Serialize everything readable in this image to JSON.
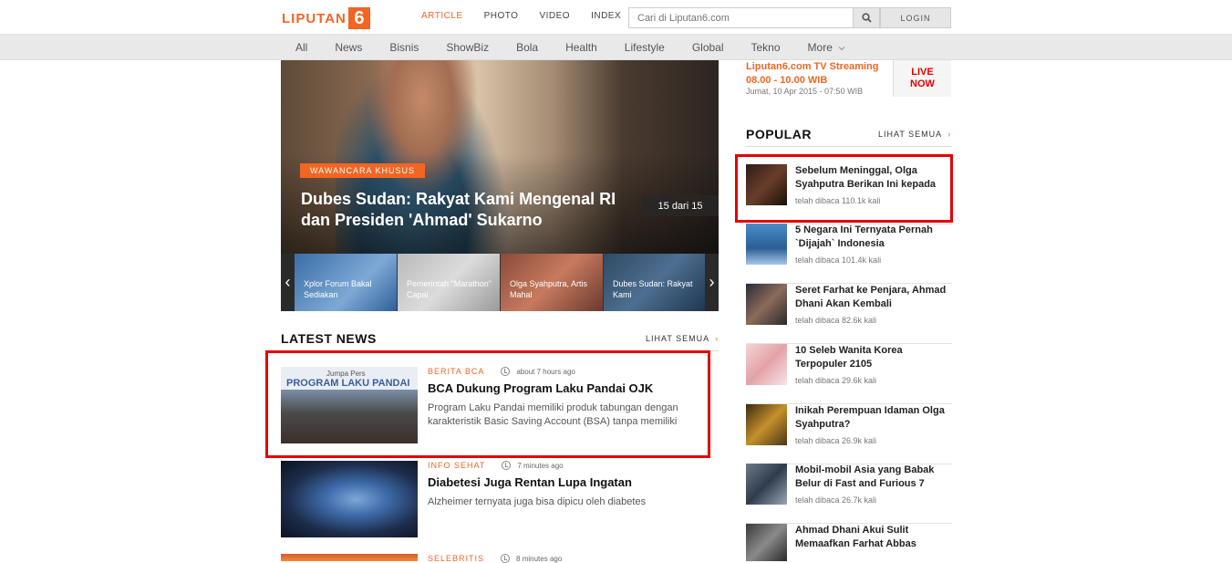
{
  "header": {
    "logo_text": "LIPUTAN",
    "logo_number": "6",
    "nav": [
      "ARTICLE",
      "PHOTO",
      "VIDEO",
      "INDEX"
    ],
    "search_placeholder": "Cari di Liputan6.com",
    "login_label": "LOGIN"
  },
  "categories": [
    "All",
    "News",
    "Bisnis",
    "ShowBiz",
    "Bola",
    "Health",
    "Lifestyle",
    "Global",
    "Tekno",
    "More"
  ],
  "hero": {
    "badge": "WAWANCARA KHUSUS",
    "title": "Dubes Sudan: Rakyat Kami Mengenal RI dan Presiden 'Ahmad' Sukarno",
    "counter": "15 dari 15",
    "thumbs": [
      "Xplor Forum Bakal Sediakan",
      "Pemerintah \"Marathon\" Capai",
      "Olga Syahputra, Artis Mahal",
      "Dubes Sudan: Rakyat Kami"
    ]
  },
  "latest": {
    "title": "LATEST NEWS",
    "link": "LIHAT SEMUA",
    "items": [
      {
        "category": "BERITA BCA",
        "time": "about 7 hours ago",
        "title": "BCA Dukung Program Laku Pandai OJK",
        "excerpt": "Program Laku Pandai memiliki produk tabungan dengan karakteristik Basic Saving Account (BSA) tanpa memiliki",
        "image_caption_1": "Jumpa Pers",
        "image_caption_2": "PROGRAM LAKU PANDAI"
      },
      {
        "category": "INFO SEHAT",
        "time": "7 minutes ago",
        "title": "Diabetesi Juga Rentan Lupa Ingatan",
        "excerpt": "Alzheimer ternyata juga bisa dipicu oleh diabetes"
      },
      {
        "category": "SELEBRITIS",
        "time": "8 minutes ago"
      }
    ]
  },
  "tv": {
    "title": "Liputan6.com TV Streaming",
    "time": "08.00 - 10.00 WIB",
    "date": "Jumat, 10 Apr 2015 - 07:50 WIB",
    "live_1": "LIVE",
    "live_2": "NOW"
  },
  "popular": {
    "title": "POPULAR",
    "link": "LIHAT SEMUA",
    "items": [
      {
        "title": "Sebelum Meninggal, Olga Syahputra Berikan Ini kepada",
        "reads": "telah dibaca 110.1k kali"
      },
      {
        "title": "5 Negara Ini Ternyata Pernah `Dijajah` Indonesia",
        "reads": "telah dibaca 101.4k kali"
      },
      {
        "title": "Seret Farhat ke Penjara, Ahmad Dhani Akan Kembali",
        "reads": "telah dibaca 82.6k kali"
      },
      {
        "title": "10 Seleb Wanita Korea Terpopuler 2105",
        "reads": "telah dibaca 29.6k kali"
      },
      {
        "title": "Inikah Perempuan Idaman Olga Syahputra?",
        "reads": "telah dibaca 26.9k kali"
      },
      {
        "title": "Mobil-mobil Asia yang Babak Belur di Fast and Furious 7",
        "reads": "telah dibaca 26.7k kali"
      },
      {
        "title": "Ahmad Dhani Akui Sulit Memaafkan Farhat Abbas",
        "reads": ""
      }
    ]
  }
}
